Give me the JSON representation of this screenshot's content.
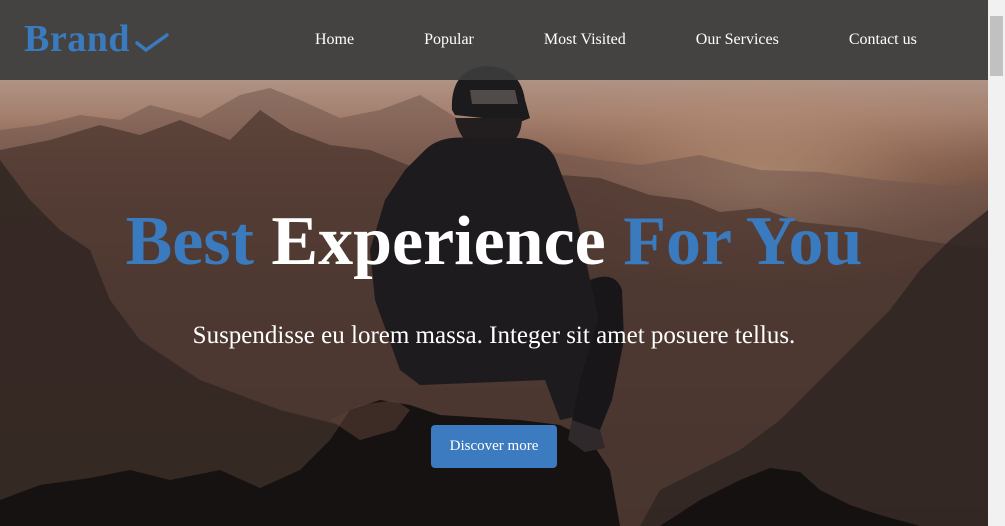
{
  "navbar": {
    "brand": "Brand",
    "links": [
      "Home",
      "Popular",
      "Most Visited",
      "Our Services",
      "Contact us"
    ]
  },
  "hero": {
    "headline": {
      "part1": "Best",
      "part2": "Experience",
      "part3": "For You"
    },
    "subtitle": "Suspendisse eu lorem massa. Integer sit amet posuere tellus.",
    "cta_label": "Discover more",
    "background_image": "man-on-mountain-photo"
  },
  "colors": {
    "accent": "#3a7bbf",
    "navbar_bg": "#3c3c3c",
    "text": "#ffffff"
  },
  "icons": {
    "brand_mark": "checkmark-icon"
  }
}
